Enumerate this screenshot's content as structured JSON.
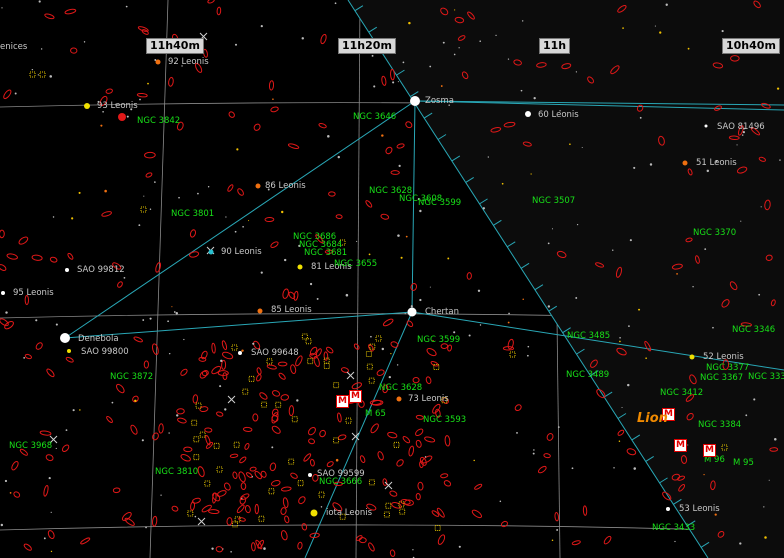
{
  "colors": {
    "background": "#000000",
    "grid": "#8a8a8a",
    "constellation_line": "#29a7b6",
    "boundary": "#29a7b6",
    "galaxy": "#e01818",
    "ngc_label": "#18e018",
    "star_label": "#c8c8c8",
    "messier_badge": "#e00000",
    "constellation_name": "#f08a00"
  },
  "ra_labels": [
    "11h40m",
    "11h20m",
    "11h",
    "10h40m"
  ],
  "partial_labels": {
    "left_edge": "enices"
  },
  "constellation": {
    "name": "Lion"
  },
  "stars": [
    {
      "name": "92 Leonis",
      "icon": "orange-star-icon"
    },
    {
      "name": "93 Leonis",
      "icon": "yellow-star-icon"
    },
    {
      "name": "Zosma",
      "icon": "white-star-icon"
    },
    {
      "name": "60 Leonis",
      "icon": "white-star-icon"
    },
    {
      "name": "SAO 81496",
      "icon": "white-star-icon"
    },
    {
      "name": "51 Leonis",
      "icon": "orange-star-icon"
    },
    {
      "name": "86 Leonis",
      "icon": "orange-star-icon"
    },
    {
      "name": "90 Leonis",
      "icon": "cyan-star-icon"
    },
    {
      "name": "81 Leonis",
      "icon": "yellow-star-icon"
    },
    {
      "name": "SAO 99812",
      "icon": "white-star-icon"
    },
    {
      "name": "95 Leonis",
      "icon": "white-star-icon"
    },
    {
      "name": "85 Leonis",
      "icon": "orange-star-icon"
    },
    {
      "name": "Chertan",
      "icon": "white-star-icon"
    },
    {
      "name": "Denebola",
      "icon": "white-star-icon"
    },
    {
      "name": "SAO 99800",
      "icon": "yellow-star-icon"
    },
    {
      "name": "SAO 99648",
      "icon": "white-star-icon"
    },
    {
      "name": "52 Leonis",
      "icon": "yellow-star-icon"
    },
    {
      "name": "73 Leonis",
      "icon": "orange-star-icon"
    },
    {
      "name": "SAO 99599",
      "icon": "white-star-icon"
    },
    {
      "name": "iota Leonis",
      "icon": "yellow-star-icon"
    },
    {
      "name": "53 Leonis",
      "icon": "white-star-icon"
    }
  ],
  "ngc_labels": [
    "NGC 3842",
    "NGC 3646",
    "NGC 3628",
    "NGC 3608",
    "NGC 3599",
    "NGC 3507",
    "NGC 3801",
    "NGC 3686",
    "NGC 3684",
    "NGC 3681",
    "NGC 3655",
    "NGC 3370",
    "NGC 3346",
    "NGC 3485",
    "NGC 3599",
    "NGC 3872",
    "NGC 3489",
    "NGC 3377",
    "NGC 3367",
    "NGC 333",
    "NGC 3412",
    "NGC 3628",
    "NGC 3593",
    "NGC 3384",
    "NGC 3968",
    "NGC 3810",
    "NGC 3666",
    "NGC 3433"
  ],
  "messier": [
    "M 96",
    "M 95",
    "M 65"
  ]
}
